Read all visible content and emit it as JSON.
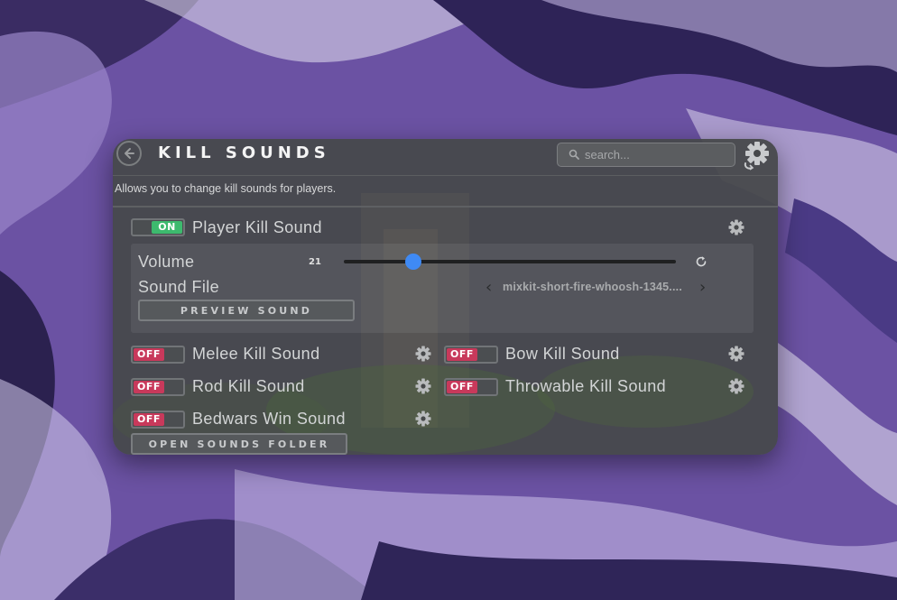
{
  "header": {
    "back_icon": "back-arrow-icon",
    "title": "KILL SOUNDS",
    "search_placeholder": "search...",
    "settings_icon": "gear-icon"
  },
  "description": "Allows you to change kill sounds for players.",
  "player_kill": {
    "toggle_state": "ON",
    "label": "Player Kill Sound",
    "settings_icon": "gear-icon",
    "volume_label": "Volume",
    "volume_value": "21",
    "volume_fraction": 0.21,
    "reset_icon": "reset-icon",
    "sound_file_label": "Sound File",
    "sound_file_value": "mixkit-short-fire-whoosh-1345....",
    "preview_button": "PREVIEW SOUND"
  },
  "sound_toggles": [
    {
      "label": "Melee Kill Sound",
      "state": "OFF"
    },
    {
      "label": "Bow Kill Sound",
      "state": "OFF"
    },
    {
      "label": "Rod Kill Sound",
      "state": "OFF"
    },
    {
      "label": "Throwable Kill Sound",
      "state": "OFF"
    },
    {
      "label": "Bedwars Win Sound",
      "state": "OFF"
    }
  ],
  "open_folder_button": "OPEN SOUNDS FOLDER",
  "colors": {
    "on": "#3dba6e",
    "off": "#c8395b",
    "accent": "#3f8af4",
    "panel": "#46484a"
  }
}
